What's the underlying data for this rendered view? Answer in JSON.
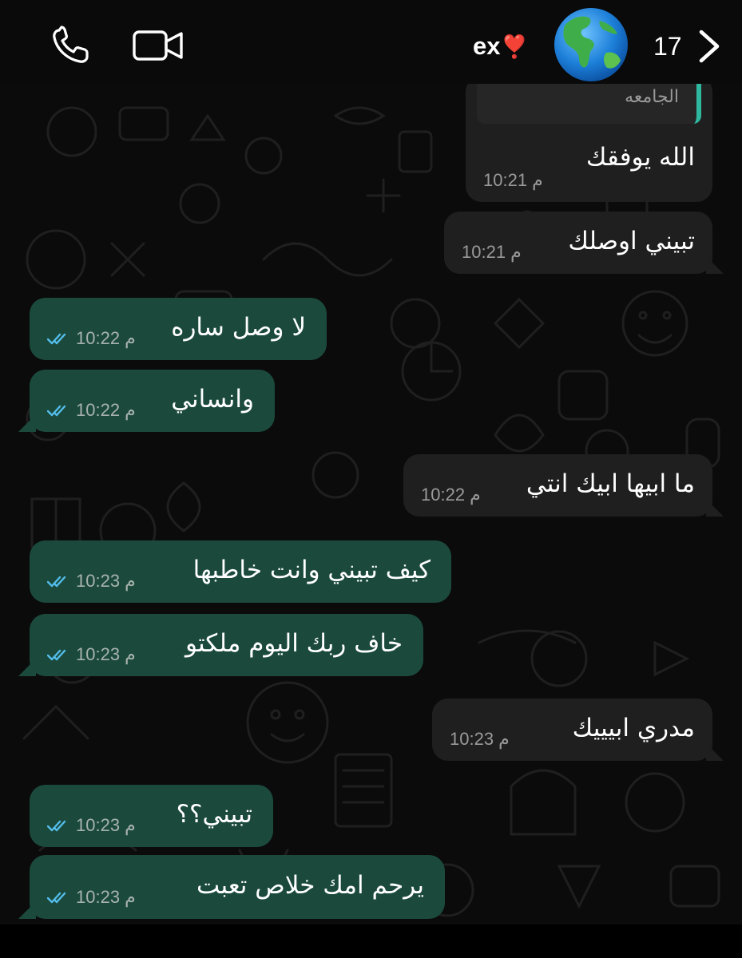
{
  "header": {
    "contact_name": "ex",
    "contact_emoji": "❣️",
    "unread_count": "17",
    "call_icon": "phone-icon",
    "video_icon": "video-camera-icon",
    "avatar_icon": "globe-americas-icon",
    "back_icon": "chevron-right-icon"
  },
  "theme": {
    "outgoing_bubble": "#1b4a3c",
    "incoming_bubble": "#1f1f1f",
    "tick_color": "#53bdeb",
    "quote_bar": "#2fb8a0"
  },
  "messages": [
    {
      "direction": "in",
      "quote": "الجامعه",
      "text": "الله يوفقك",
      "time": "10:21 م"
    },
    {
      "direction": "in",
      "text": "تبيني اوصلك",
      "time": "10:21 م"
    },
    {
      "direction": "out",
      "text": "لا وصل ساره",
      "time": "10:22 م"
    },
    {
      "direction": "out",
      "text": "وانساني",
      "time": "10:22 م"
    },
    {
      "direction": "in",
      "text": "ما ابيها ابيك انتي",
      "time": "10:22 م"
    },
    {
      "direction": "out",
      "text": "كيف تبيني وانت خاطبها",
      "time": "10:23 م"
    },
    {
      "direction": "out",
      "text": "خاف ربك اليوم ملكتو",
      "time": "10:23 م"
    },
    {
      "direction": "in",
      "text": "مدري ابيييك",
      "time": "10:23 م"
    },
    {
      "direction": "out",
      "text": "تبيني؟؟",
      "time": "10:23 م"
    },
    {
      "direction": "out",
      "text": "يرحم امك خلاص تعبت",
      "time": "10:23 م"
    }
  ]
}
